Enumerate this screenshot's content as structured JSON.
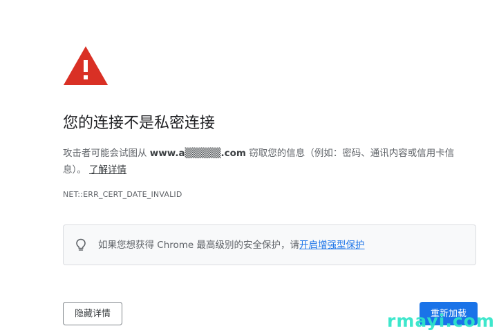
{
  "page": {
    "heading": "您的连接不是私密连接",
    "body_prefix": "攻击者可能会试图从 ",
    "domain": "www.a▒▒▒▒▒.com",
    "body_suffix": " 窃取您的信息（例如：密码、通讯内容或信用卡信息）。",
    "learn_more": "了解详情",
    "error_code": "NET::ERR_CERT_DATE_INVALID"
  },
  "enhanced_protection": {
    "icon": "lightbulb-icon",
    "text": "如果您想获得 Chrome 最高级别的安全保护，请",
    "link": "开启增强型保护"
  },
  "buttons": {
    "details": "隐藏详情",
    "reload": "重新加载"
  },
  "watermark": "rmayi.com",
  "colors": {
    "warning_red": "#d93025",
    "link_blue": "#1a73e8",
    "button_blue": "#1a73e8",
    "watermark": "#2ee6c8"
  }
}
